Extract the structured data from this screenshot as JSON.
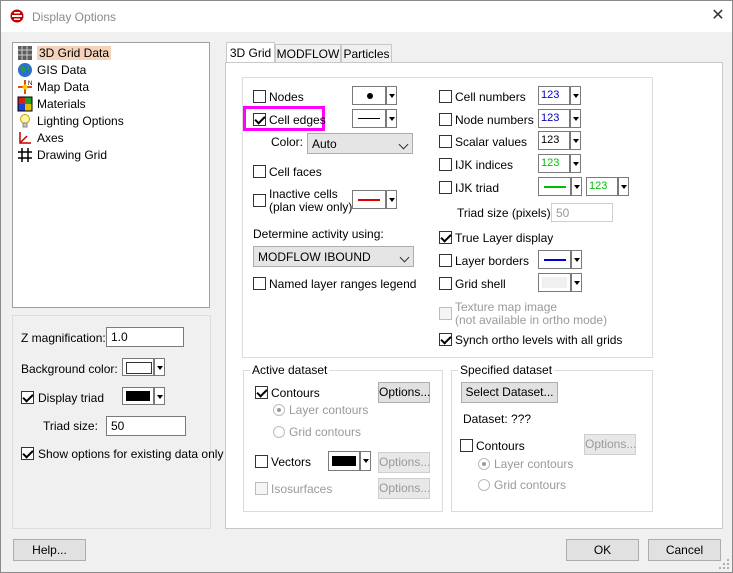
{
  "window": {
    "title": "Display Options"
  },
  "tree": {
    "items": [
      {
        "label": "3D Grid Data",
        "icon": "grid3d-icon"
      },
      {
        "label": "GIS Data",
        "icon": "globe-icon"
      },
      {
        "label": "Map Data",
        "icon": "map-icon"
      },
      {
        "label": "Materials",
        "icon": "materials-icon"
      },
      {
        "label": "Lighting Options",
        "icon": "lightbulb-icon"
      },
      {
        "label": "Axes",
        "icon": "axes-icon"
      },
      {
        "label": "Drawing Grid",
        "icon": "drawing-grid-icon"
      }
    ]
  },
  "left": {
    "z_mag_label": "Z magnification:",
    "z_mag_value": "1.0",
    "bg_label": "Background color:",
    "display_triad_label": "Display triad",
    "triad_size_label": "Triad size:",
    "triad_size_value": "50",
    "show_options_label": "Show options for existing data only"
  },
  "tabs": [
    "3D Grid",
    "MODFLOW",
    "Particles"
  ],
  "grid": {
    "nodes": "Nodes",
    "cell_edges": "Cell edges",
    "color_label": "Color:",
    "color_value": "Auto",
    "cell_faces": "Cell faces",
    "inactive_cells_1": "Inactive cells",
    "inactive_cells_2": "(plan view only)",
    "determine_label": "Determine activity using:",
    "determine_value": "MODFLOW IBOUND",
    "named_layer": "Named layer ranges legend",
    "cell_numbers": "Cell numbers",
    "node_numbers": "Node numbers",
    "scalar_values": "Scalar values",
    "ijk_indices": "IJK indices",
    "ijk_triad": "IJK triad",
    "triad_size_px_label": "Triad size (pixels):",
    "triad_size_px_value": "50",
    "true_layer": "True Layer display",
    "layer_borders": "Layer borders",
    "grid_shell": "Grid shell",
    "texture_1": "Texture map image",
    "texture_2": "(not available in ortho mode)",
    "synch": "Synch ortho levels with all grids",
    "num_text": "123"
  },
  "active_dataset": {
    "title": "Active dataset",
    "contours": "Contours",
    "options": "Options...",
    "layer_contours": "Layer contours",
    "grid_contours": "Grid contours",
    "vectors": "Vectors",
    "isosurfaces": "Isosurfaces"
  },
  "specified_dataset": {
    "title": "Specified dataset",
    "select": "Select Dataset...",
    "dataset": "Dataset: ???",
    "contours": "Contours",
    "options": "Options...",
    "layer_contours": "Layer contours",
    "grid_contours": "Grid contours"
  },
  "footer": {
    "help": "Help...",
    "ok": "OK",
    "cancel": "Cancel"
  },
  "colors": {
    "highlight": "#ff00ff",
    "selection": "#f5d3bb",
    "blue_num": "#0000c0",
    "green_num": "#00c000",
    "red_line": "#e00000",
    "blue_line": "#0000d0",
    "green_line": "#00c000"
  }
}
